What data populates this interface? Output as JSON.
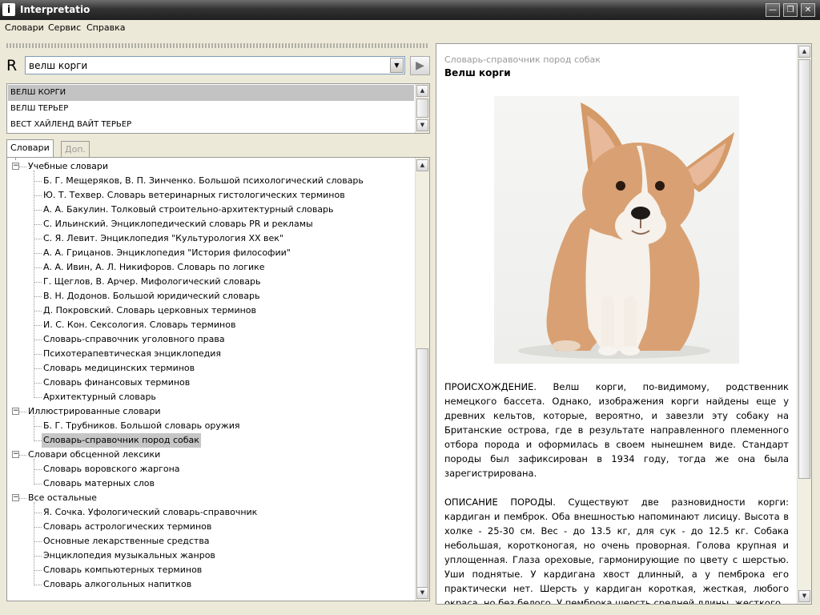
{
  "window": {
    "title": "Interpretatio",
    "icon_letter": "i"
  },
  "menu": [
    "Словари",
    "Сервис",
    "Справка"
  ],
  "search": {
    "prefix": "R",
    "value": "велш корги",
    "go_glyph": "▶"
  },
  "results": [
    {
      "text": "ВЕЛШ КОРГИ",
      "selected": true
    },
    {
      "text": "ВЕЛШ ТЕРЬЕР",
      "selected": false
    },
    {
      "text": "ВЕСТ ХАЙЛЕНД ВАЙТ ТЕРЬЕР",
      "selected": false
    }
  ],
  "tabs": [
    {
      "label": "Словари",
      "active": true
    },
    {
      "label": "Доп.",
      "active": false
    }
  ],
  "tree": [
    {
      "label": "Учебные словари",
      "children": [
        "Б. Г. Мещеряков, В. П. Зинченко. Большой психологический словарь",
        "Ю. Т. Техвер. Словарь ветеринарных гистологических терминов",
        "А. А. Бакулин. Толковый строительно-архитектурный словарь",
        "С. Ильинский. Энциклопедический словарь PR и рекламы",
        "С. Я. Левит. Энциклопедия \"Культурология XX век\"",
        "А. А. Грицанов. Энциклопедия \"История философии\"",
        "А. А. Ивин, А. Л. Никифоров. Словарь по логике",
        "Г. Щеглов, В. Арчер. Мифологический словарь",
        "В. Н. Додонов. Большой юридический словарь",
        "Д. Покровский. Словарь церковных терминов",
        "И. С. Кон. Сексология. Словарь терминов",
        "Словарь-справочник уголовного права",
        "Психотерапевтическая энциклопедия",
        "Словарь медицинских терминов",
        "Словарь финансовых терминов",
        "Архитектурный словарь"
      ]
    },
    {
      "label": "Иллюстрированные словари",
      "children": [
        "Б. Г. Трубников. Большой словарь оружия",
        "Словарь-справочник пород собак"
      ]
    },
    {
      "label": "Словари обсценной лексики",
      "children": [
        "Словарь воровского жаргона",
        "Словарь матерных слов"
      ]
    },
    {
      "label": "Все остальные",
      "children": [
        "Я. Сочка. Уфологический словарь-справочник",
        "Словарь астрологических терминов",
        "Основные лекарственные средства",
        "Энциклопедия музыкальных жанров",
        "Словарь компьютерных терминов",
        "Словарь алкогольных напитков"
      ]
    }
  ],
  "tree_selected": "Словарь-справочник пород собак",
  "article": {
    "source": "Словарь-справочник пород собак",
    "title": "Велш корги",
    "paragraphs": [
      "ПРОИСХОЖДЕНИЕ. Велш корги, по-видимому, родственник немецкого бассета. Однако, изображения корги найдены еще у древних кельтов, которые, вероятно, и завезли эту собаку на Британские острова, где в результате направленного племенного отбора порода и оформилась в своем нынешнем виде. Стандарт породы был зафиксирован в 1934 году, тогда же она была зарегистрирована.",
      "ОПИСАНИЕ ПОРОДЫ. Существуют две разновидности корги: кардиган и пемброк. Оба внешностью напоминают лисицу. Высота в холке - 25-30 см. Вес - до 13.5 кг, для сук - до 12.5 кг. Собака небольшая, коротконогая, но очень проворная. Голова крупная и уплощенная. Глаза ореховые, гармонирующие по цвету с шерстью. Уши поднятые. У кардигана хвост длинный, а у пемброка его практически нет. Шерсть у кардиган короткая, жесткая, любого окраса, но без белого. У пемброка шерсть средней длины, жесткого"
    ]
  }
}
